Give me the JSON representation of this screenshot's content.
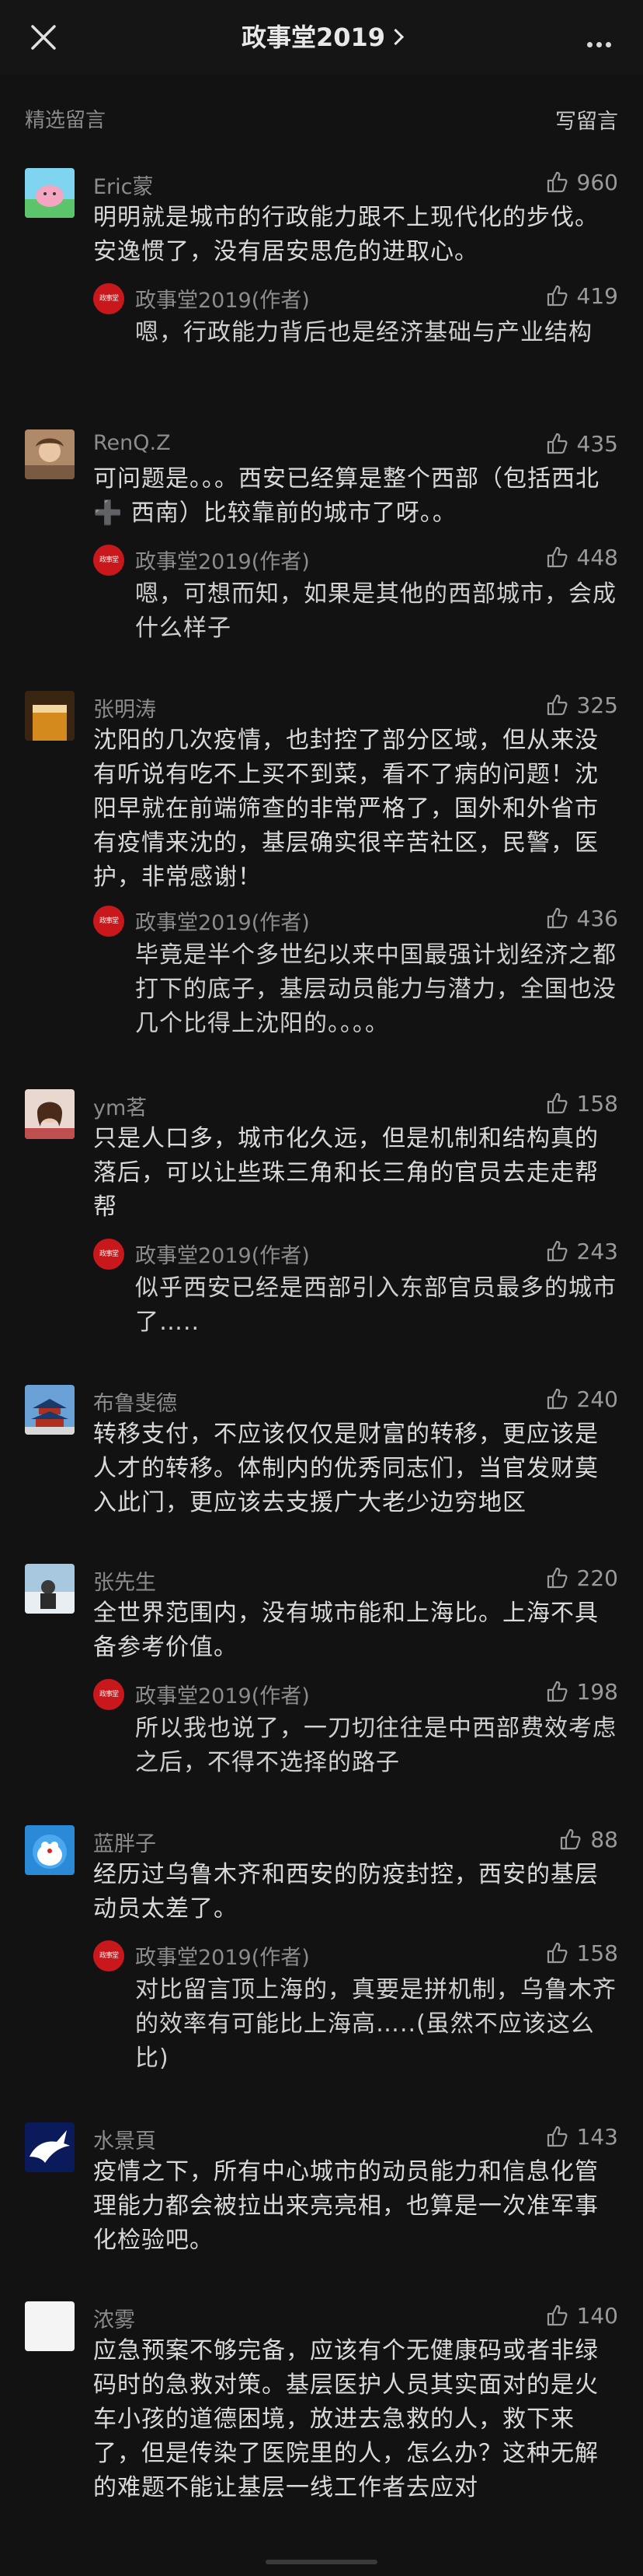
{
  "header": {
    "title": "政事堂2019",
    "close_icon": "close-icon",
    "more_icon": "more-icon"
  },
  "section": {
    "label": "精选留言",
    "write_label": "写留言"
  },
  "author_avatar_text": "政事堂",
  "comments": [
    {
      "name": "Eric蒙",
      "likes": "960",
      "text": "明明就是城市的行政能力跟不上现代化的步伐。安逸惯了，没有居安思危的进取心。",
      "reply": {
        "name": "政事堂2019(作者)",
        "likes": "419",
        "text": "嗯，行政能力背后也是经济基础与产业结构"
      }
    },
    {
      "name": "RenQ.Z",
      "likes": "435",
      "text": "可问题是。。。西安已经算是整个西部（包括西北 ➕ 西南）比较靠前的城市了呀。。",
      "reply": {
        "name": "政事堂2019(作者)",
        "likes": "448",
        "text": "嗯，可想而知，如果是其他的西部城市，会成什么样子"
      }
    },
    {
      "name": "张明涛",
      "likes": "325",
      "text": "沈阳的几次疫情，也封控了部分区域，但从来没有听说有吃不上买不到菜，看不了病的问题！沈阳早就在前端筛查的非常严格了，国外和外省市有疫情来沈的，基层确实很辛苦社区，民警，医护，非常感谢！",
      "reply": {
        "name": "政事堂2019(作者)",
        "likes": "436",
        "text": "毕竟是半个多世纪以来中国最强计划经济之都打下的底子，基层动员能力与潜力，全国也没几个比得上沈阳的。。。。"
      }
    },
    {
      "name": "ym茗",
      "likes": "158",
      "text": "只是人口多，城市化久远，但是机制和结构真的落后，可以让些珠三角和长三角的官员去走走帮帮",
      "reply": {
        "name": "政事堂2019(作者)",
        "likes": "243",
        "text": "似乎西安已经是西部引入东部官员最多的城市了….."
      }
    },
    {
      "name": "布鲁斐德",
      "likes": "240",
      "text": "转移支付，不应该仅仅是财富的转移，更应该是人才的转移。体制内的优秀同志们，当官发财莫入此门，更应该去支援广大老少边穷地区",
      "reply": null
    },
    {
      "name": "张先生",
      "likes": "220",
      "text": "全世界范围内，没有城市能和上海比。上海不具备参考价值。",
      "reply": {
        "name": "政事堂2019(作者)",
        "likes": "198",
        "text": "所以我也说了，一刀切往往是中西部费效考虑之后，不得不选择的路子"
      }
    },
    {
      "name": "蓝胖子",
      "likes": "88",
      "text": "经历过乌鲁木齐和西安的防疫封控，西安的基层动员太差了。",
      "reply": {
        "name": "政事堂2019(作者)",
        "likes": "158",
        "text": "对比留言顶上海的，真要是拼机制，乌鲁木齐的效率有可能比上海高…..(虽然不应该这么比)"
      }
    },
    {
      "name": "水景頁",
      "likes": "143",
      "text": "疫情之下，所有中心城市的动员能力和信息化管理能力都会被拉出来亮亮相，也算是一次准军事化检验吧。",
      "reply": null
    },
    {
      "name": "浓雾",
      "likes": "140",
      "text": "应急预案不够完备，应该有个无健康码或者非绿码时的急救对策。基层医护人员其实面对的是火车小孩的道德困境，放进去急救的人，救下来了，但是传染了医院里的人，怎么办？这种无解的难题不能让基层一线工作者去应对",
      "reply": null
    }
  ]
}
